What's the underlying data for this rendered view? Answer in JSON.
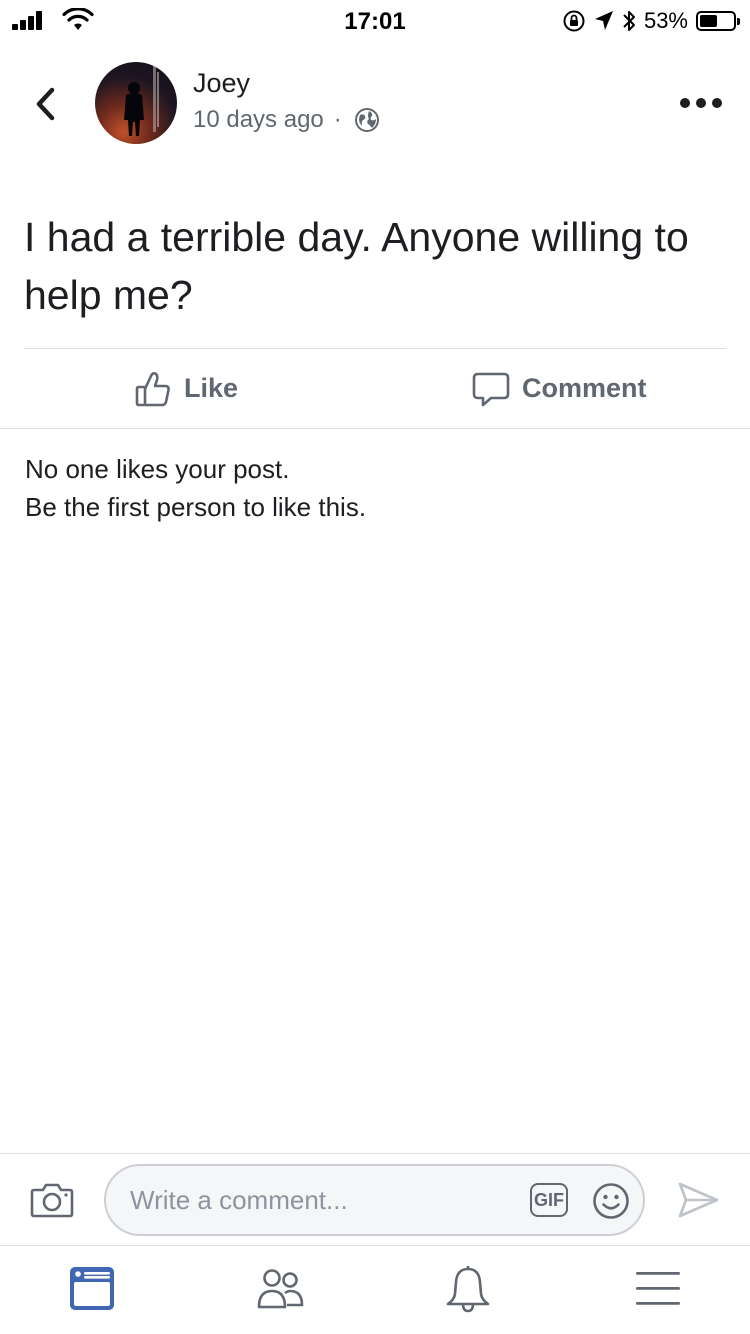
{
  "status_bar": {
    "time": "17:01",
    "battery_percent": "53%",
    "battery_level": 0.53,
    "icons": [
      "signal-icon",
      "wifi-icon",
      "orientation-lock-icon",
      "location-icon",
      "bluetooth-icon",
      "battery-icon"
    ]
  },
  "header": {
    "author_name": "Joey",
    "timestamp": "10 days ago",
    "separator": "·",
    "privacy_icon": "globe-icon"
  },
  "post": {
    "text": "I had a terrible day. Anyone willing to help me?"
  },
  "actions": {
    "like_label": "Like",
    "comment_label": "Comment"
  },
  "reactions": {
    "line1": "No one likes your post.",
    "line2": "Be the first person to like this."
  },
  "composer": {
    "placeholder": "Write a comment...",
    "gif_label": "GIF",
    "value": ""
  },
  "tab_bar": {
    "tabs": [
      "news-feed-icon",
      "friends-icon",
      "notifications-icon",
      "menu-icon"
    ],
    "active_color": "#4267b2",
    "inactive_color": "#606770"
  }
}
